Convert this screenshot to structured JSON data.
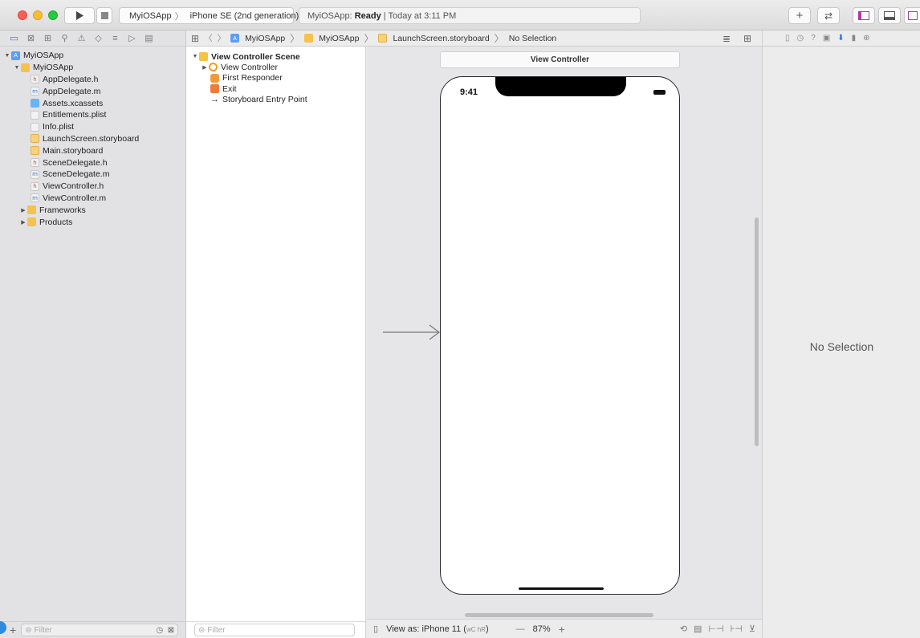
{
  "toolbar": {
    "scheme_app": "MyiOSApp",
    "scheme_device": "iPhone SE (2nd generation)",
    "status_app": "MyiOSApp:",
    "status_state": "Ready",
    "status_time": "| Today at 3:11 PM"
  },
  "navigator": {
    "items": [
      {
        "label": "MyiOSApp",
        "icon": "project-icon"
      },
      {
        "label": "MyiOSApp",
        "icon": "folder-icon"
      },
      {
        "label": "AppDelegate.h",
        "icon": "header-file-icon"
      },
      {
        "label": "AppDelegate.m",
        "icon": "objc-file-icon"
      },
      {
        "label": "Assets.xcassets",
        "icon": "assets-icon"
      },
      {
        "label": "Entitlements.plist",
        "icon": "plist-icon"
      },
      {
        "label": "Info.plist",
        "icon": "plist-icon"
      },
      {
        "label": "LaunchScreen.storyboard",
        "icon": "storyboard-icon"
      },
      {
        "label": "Main.storyboard",
        "icon": "storyboard-icon"
      },
      {
        "label": "SceneDelegate.h",
        "icon": "header-file-icon"
      },
      {
        "label": "SceneDelegate.m",
        "icon": "objc-file-icon"
      },
      {
        "label": "ViewController.h",
        "icon": "header-file-icon"
      },
      {
        "label": "ViewController.m",
        "icon": "objc-file-icon"
      },
      {
        "label": "Frameworks",
        "icon": "folder-icon"
      },
      {
        "label": "Products",
        "icon": "folder-icon"
      }
    ],
    "filter_placeholder": "Filter"
  },
  "jumpbar": {
    "crumbs": [
      "MyiOSApp",
      "MyiOSApp",
      "LaunchScreen.storyboard",
      "No Selection"
    ]
  },
  "outline": {
    "items": [
      {
        "label": "View Controller Scene"
      },
      {
        "label": "View Controller"
      },
      {
        "label": "First Responder"
      },
      {
        "label": "Exit"
      },
      {
        "label": "Storyboard Entry Point"
      }
    ],
    "filter_placeholder": "Filter"
  },
  "canvas": {
    "scene_title": "View Controller",
    "status_time": "9:41"
  },
  "canvas_footer": {
    "view_as": "View as: iPhone 11 (",
    "size_class": "wC hR",
    "view_as_end": ")",
    "zoom_minus": "—",
    "zoom": "87%",
    "zoom_plus": "+"
  },
  "inspector": {
    "empty_label": "No Selection"
  }
}
